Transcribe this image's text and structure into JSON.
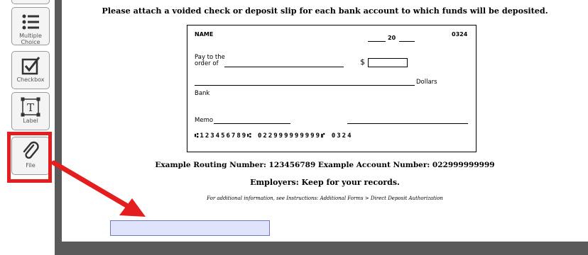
{
  "toolbar": {
    "items": [
      {
        "label": "Multiple\nChoice",
        "icon": "multiple-choice-icon"
      },
      {
        "label": "Checkbox",
        "icon": "checkbox-icon"
      },
      {
        "label": "Label",
        "icon": "text-label-icon"
      },
      {
        "label": "File",
        "icon": "paperclip-icon"
      }
    ]
  },
  "document": {
    "instruction": "Please attach a voided check or deposit slip for each bank account to which funds will be deposited.",
    "check": {
      "name": "NAME",
      "year_prefix": "20",
      "number": "0324",
      "pay_to_line1": "Pay to the",
      "pay_to_line2": "order of",
      "dollar_sign": "$",
      "dollars": "Dollars",
      "bank": "Bank",
      "memo": "Memo",
      "micr_line": "⑆123456789⑆  022999999999⑈   0324"
    },
    "example_line": "Example Routing Number: 123456789   Example Account Number: 022999999999",
    "employers_line": "Employers: Keep for your records.",
    "additional_info": "For additional information, see Instructions: Additional Forms > Direct Deposit Authorization"
  },
  "colors": {
    "highlight": "#e41e1e",
    "drop_field_fill": "#dfe3fb",
    "drop_field_border": "#6f78c6",
    "frame": "#5a5a5a"
  }
}
